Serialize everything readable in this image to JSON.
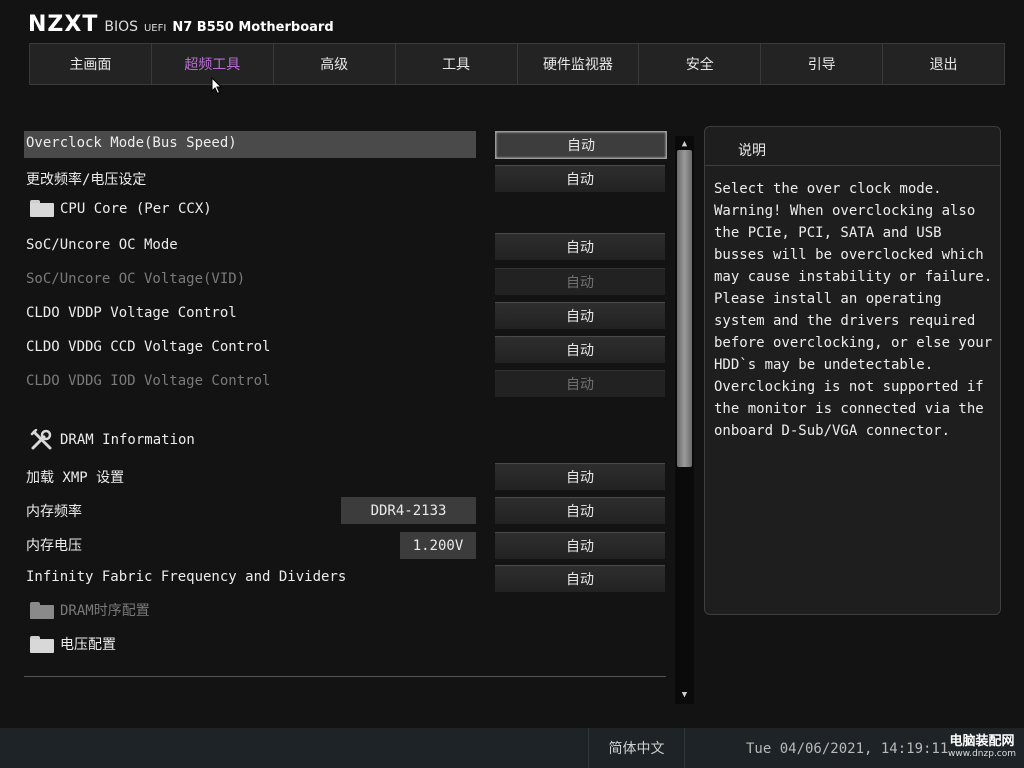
{
  "header": {
    "logo": "NZXT",
    "bios": "BIOS",
    "uefi": "UEFI",
    "model": "N7 B550 Motherboard"
  },
  "tabs": [
    "主画面",
    "超频工具",
    "高级",
    "工具",
    "硬件监视器",
    "安全",
    "引导",
    "退出"
  ],
  "active_tab": "超频工具",
  "settings": {
    "overclock_mode": {
      "label": "Overclock Mode(Bus Speed)",
      "value": "自动"
    },
    "freq_voltage": {
      "label": "更改频率/电压设定",
      "value": "自动"
    },
    "cpu_core": {
      "label": "CPU Core (Per CCX)"
    },
    "soc_oc_mode": {
      "label": "SoC/Uncore OC Mode",
      "value": "自动"
    },
    "soc_oc_voltage": {
      "label": "SoC/Uncore OC Voltage(VID)",
      "value": "自动"
    },
    "cldo_vddp": {
      "label": "CLDO VDDP Voltage Control",
      "value": "自动"
    },
    "cldo_vddg_ccd": {
      "label": "CLDO VDDG CCD Voltage Control",
      "value": "自动"
    },
    "cldo_vddg_iod": {
      "label": "CLDO VDDG IOD Voltage Control",
      "value": "自动"
    },
    "dram_info": {
      "label": "DRAM Information"
    },
    "xmp": {
      "label": "加载 XMP 设置",
      "value": "自动"
    },
    "mem_freq": {
      "label": "内存频率",
      "current": "DDR4-2133",
      "value": "自动"
    },
    "mem_voltage": {
      "label": "内存电压",
      "current": "1.200V",
      "value": "自动"
    },
    "infinity_fabric": {
      "label": "Infinity Fabric Frequency and Dividers",
      "value": "自动"
    },
    "dram_timing": {
      "label": "DRAM时序配置"
    },
    "voltage_config": {
      "label": "电压配置"
    }
  },
  "help": {
    "title": "说明",
    "text": "Select the over clock mode.\nWarning! When overclocking also\nthe PCIe, PCI, SATA and USB\nbusses will be overclocked which\nmay cause instability or failure.\nPlease install an operating\nsystem and the drivers required\nbefore overclocking, or else your\nHDD`s may be undetectable.\nOverclocking is not supported if\nthe monitor is connected via the\nonboard D-Sub/VGA connector."
  },
  "footer": {
    "language": "简体中文",
    "datetime": "Tue 04/06/2021, 14:19:11"
  },
  "watermark": {
    "name": "电脑装配网",
    "url": "www.dnzp.com"
  },
  "colors": {
    "active_tab": "#b86ed3",
    "background": "#131313",
    "footer": "#1d2326"
  }
}
